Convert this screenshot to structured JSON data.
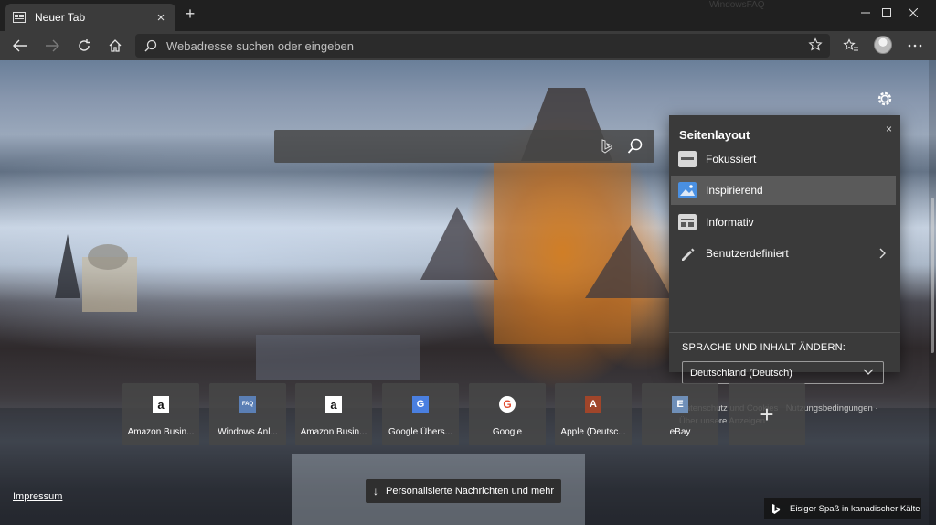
{
  "window": {
    "tab_title": "Neuer Tab",
    "new_tab_symbol": "+",
    "close_tab_symbol": "×",
    "watermark": "WindowsFAQ"
  },
  "toolbar": {
    "address_placeholder": "Webadresse suchen oder eingeben"
  },
  "flyout": {
    "title": "Seitenlayout",
    "close_symbol": "×",
    "items": [
      {
        "label": "Fokussiert",
        "icon": "focused-layout-icon",
        "selected": false
      },
      {
        "label": "Inspirierend",
        "icon": "inspirational-layout-icon",
        "selected": true
      },
      {
        "label": "Informativ",
        "icon": "informational-layout-icon",
        "selected": false
      },
      {
        "label": "Benutzerdefiniert",
        "icon": "custom-layout-icon",
        "selected": false
      }
    ],
    "language_heading": "SPRACHE UND INHALT ÄNDERN:",
    "language_value": "Deutschland (Deutsch)",
    "footer_line1": "Datenschutz und Cookies · Nutzungsbedingungen ·",
    "footer_line2": "Über unsere Anzeigen"
  },
  "quick_links": [
    {
      "label": "Amazon Busin...",
      "icon": "amazon-icon",
      "glyph": "a"
    },
    {
      "label": "Windows Anl...",
      "icon": "windowsfaq-icon",
      "glyph": "FAQ"
    },
    {
      "label": "Amazon Busin...",
      "icon": "amazon-icon",
      "glyph": "a"
    },
    {
      "label": "Google Übers...",
      "icon": "google-translate-icon",
      "glyph": "G"
    },
    {
      "label": "Google",
      "icon": "google-icon",
      "glyph": "G"
    },
    {
      "label": "Apple (Deutsc...",
      "icon": "apple-letter-icon",
      "glyph": "A"
    },
    {
      "label": "eBay",
      "icon": "ebay-letter-icon",
      "glyph": "E"
    }
  ],
  "add_tile_symbol": "+",
  "footer": {
    "impressum": "Impressum",
    "news_button": "Personalisierte Nachrichten und mehr",
    "news_arrow": "↓",
    "image_credit": "Eisiger Spaß in kanadischer Kälte"
  },
  "colors": {
    "chrome_dark": "#202020",
    "toolbar": "#3b3b3b",
    "flyout_bg": "#3a3a3a",
    "selected_item": "#5a5a5a",
    "layout_icon_blue": "#4a90e2",
    "amazon_orange": "#ff9900",
    "apple_tile": "#a0452a",
    "ebay_tile": "#6f8fb8"
  }
}
